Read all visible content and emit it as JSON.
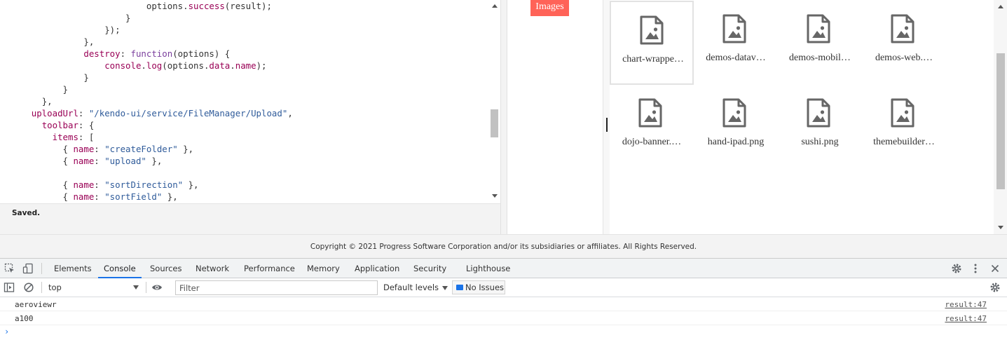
{
  "editor": {
    "lines": [
      [
        [
          "",
          "                            "
        ],
        [
          "fn",
          "options"
        ],
        [
          "pun",
          "."
        ],
        [
          "prop",
          "success"
        ],
        [
          "pun",
          "(result);"
        ]
      ],
      [
        [
          "",
          "                        "
        ],
        [
          "pun",
          "}"
        ]
      ],
      [
        [
          "",
          "                    "
        ],
        [
          "pun",
          "});"
        ]
      ],
      [
        [
          "",
          "                "
        ],
        [
          "pun",
          "},"
        ]
      ],
      [
        [
          "",
          "                "
        ],
        [
          "prop",
          "destroy"
        ],
        [
          "pun",
          ": "
        ],
        [
          "kw",
          "function"
        ],
        [
          "pun",
          "(options) {"
        ]
      ],
      [
        [
          "",
          "                    "
        ],
        [
          "prop",
          "console"
        ],
        [
          "pun",
          "."
        ],
        [
          "prop",
          "log"
        ],
        [
          "pun",
          "(options."
        ],
        [
          "prop",
          "data"
        ],
        [
          "pun",
          "."
        ],
        [
          "prop",
          "name"
        ],
        [
          "pun",
          ");"
        ]
      ],
      [
        [
          "",
          "                "
        ],
        [
          "pun",
          "}"
        ]
      ],
      [
        [
          "",
          "            "
        ],
        [
          "pun",
          "}"
        ]
      ],
      [
        [
          "",
          "        "
        ],
        [
          "pun",
          "},"
        ]
      ],
      [
        [
          "",
          "      "
        ],
        [
          "prop",
          "uploadUrl"
        ],
        [
          "pun",
          ": "
        ],
        [
          "str",
          "\"/kendo-ui/service/FileManager/Upload\""
        ],
        [
          "pun",
          ","
        ]
      ],
      [
        [
          "",
          "        "
        ],
        [
          "prop",
          "toolbar"
        ],
        [
          "pun",
          ": {"
        ]
      ],
      [
        [
          "",
          "          "
        ],
        [
          "prop",
          "items"
        ],
        [
          "pun",
          ": ["
        ]
      ],
      [
        [
          "",
          "            "
        ],
        [
          "pun",
          "{ "
        ],
        [
          "prop",
          "name"
        ],
        [
          "pun",
          ": "
        ],
        [
          "str",
          "\"createFolder\""
        ],
        [
          "pun",
          " },"
        ]
      ],
      [
        [
          "",
          "            "
        ],
        [
          "pun",
          "{ "
        ],
        [
          "prop",
          "name"
        ],
        [
          "pun",
          ": "
        ],
        [
          "str",
          "\"upload\""
        ],
        [
          "pun",
          " },"
        ]
      ],
      [
        [
          "",
          ""
        ]
      ],
      [
        [
          "",
          "            "
        ],
        [
          "pun",
          "{ "
        ],
        [
          "prop",
          "name"
        ],
        [
          "pun",
          ": "
        ],
        [
          "str",
          "\"sortDirection\""
        ],
        [
          "pun",
          " },"
        ]
      ],
      [
        [
          "",
          "            "
        ],
        [
          "pun",
          "{ "
        ],
        [
          "prop",
          "name"
        ],
        [
          "pun",
          ": "
        ],
        [
          "str",
          "\"sortField\""
        ],
        [
          "pun",
          " },"
        ]
      ]
    ],
    "status": "Saved."
  },
  "result": {
    "badge": "Images",
    "files": [
      {
        "name": "chart-wrappe…",
        "selected": true
      },
      {
        "name": "demos-datav…",
        "selected": false
      },
      {
        "name": "demos-mobil…",
        "selected": false
      },
      {
        "name": "demos-web.…",
        "selected": false
      },
      {
        "name": "dojo-banner.…",
        "selected": false
      },
      {
        "name": "hand-ipad.png",
        "selected": false
      },
      {
        "name": "sushi.png",
        "selected": false
      },
      {
        "name": "themebuilder…",
        "selected": false
      }
    ]
  },
  "footer": {
    "copyright": "Copyright © 2021 Progress Software Corporation and/or its subsidiaries or affiliates. All Rights Reserved."
  },
  "devtools": {
    "tabs": [
      {
        "label": "Elements",
        "active": false
      },
      {
        "label": "Console",
        "active": true
      },
      {
        "label": "Sources",
        "active": false
      },
      {
        "label": "Network",
        "active": false
      },
      {
        "label": "Performance",
        "active": false
      },
      {
        "label": "Memory",
        "active": false
      },
      {
        "label": "Application",
        "active": false
      },
      {
        "label": "Security",
        "active": false
      },
      {
        "label": "Lighthouse",
        "active": false
      }
    ],
    "context": "top",
    "filter_placeholder": "Filter",
    "levels_label": "Default levels",
    "issues_label": "No Issues",
    "logs": [
      {
        "message": "aeroviewr",
        "source": "result:47"
      },
      {
        "message": "a100",
        "source": "result:47"
      }
    ],
    "prompt": "›"
  },
  "colors": {
    "accent": "#1a73e8",
    "badge": "#ff6358"
  }
}
